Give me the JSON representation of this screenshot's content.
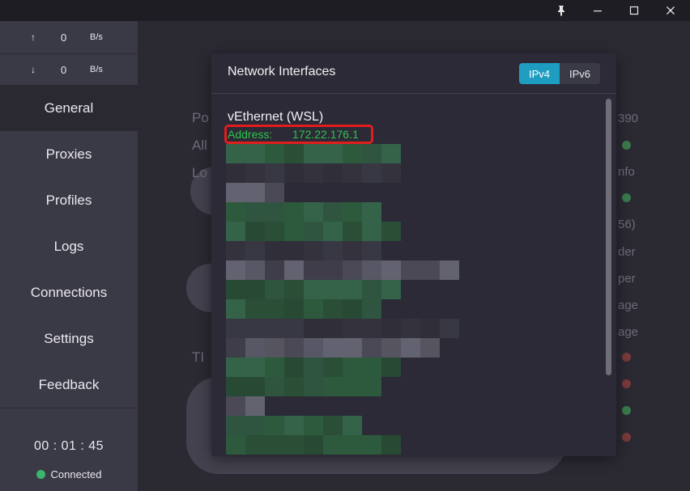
{
  "window_controls": {
    "pin_icon": "pin-icon",
    "minimize_icon": "minimize-icon",
    "maximize_icon": "maximize-icon",
    "close_icon": "close-icon"
  },
  "sidebar": {
    "upload": {
      "arrow": "↑",
      "value": "0",
      "unit": "B/s"
    },
    "download": {
      "arrow": "↓",
      "value": "0",
      "unit": "B/s"
    },
    "items": [
      {
        "label": "General",
        "active": true
      },
      {
        "label": "Proxies"
      },
      {
        "label": "Profiles"
      },
      {
        "label": "Logs"
      },
      {
        "label": "Connections"
      },
      {
        "label": "Settings"
      },
      {
        "label": "Feedback"
      }
    ],
    "timer": "00 : 01 : 45",
    "status": {
      "label": "Connected",
      "color": "#3bb56c"
    }
  },
  "background": {
    "partial_texts": [
      "Po",
      "All",
      "Lo",
      "390",
      "nfo",
      "56)",
      "der",
      "per",
      "age",
      "age",
      "TI"
    ]
  },
  "modal": {
    "title": "Network Interfaces",
    "toggle": {
      "options": [
        "IPv4",
        "IPv6"
      ],
      "selected": "IPv4",
      "accent": "#1f9dc1"
    },
    "interface": {
      "name": "vEthernet (WSL)",
      "address_label": "Address:",
      "address_value": "172.22.176.1",
      "highlight_color": "#e21d1d",
      "text_color": "#2ec44d"
    },
    "redacted_list": "pixelated"
  }
}
